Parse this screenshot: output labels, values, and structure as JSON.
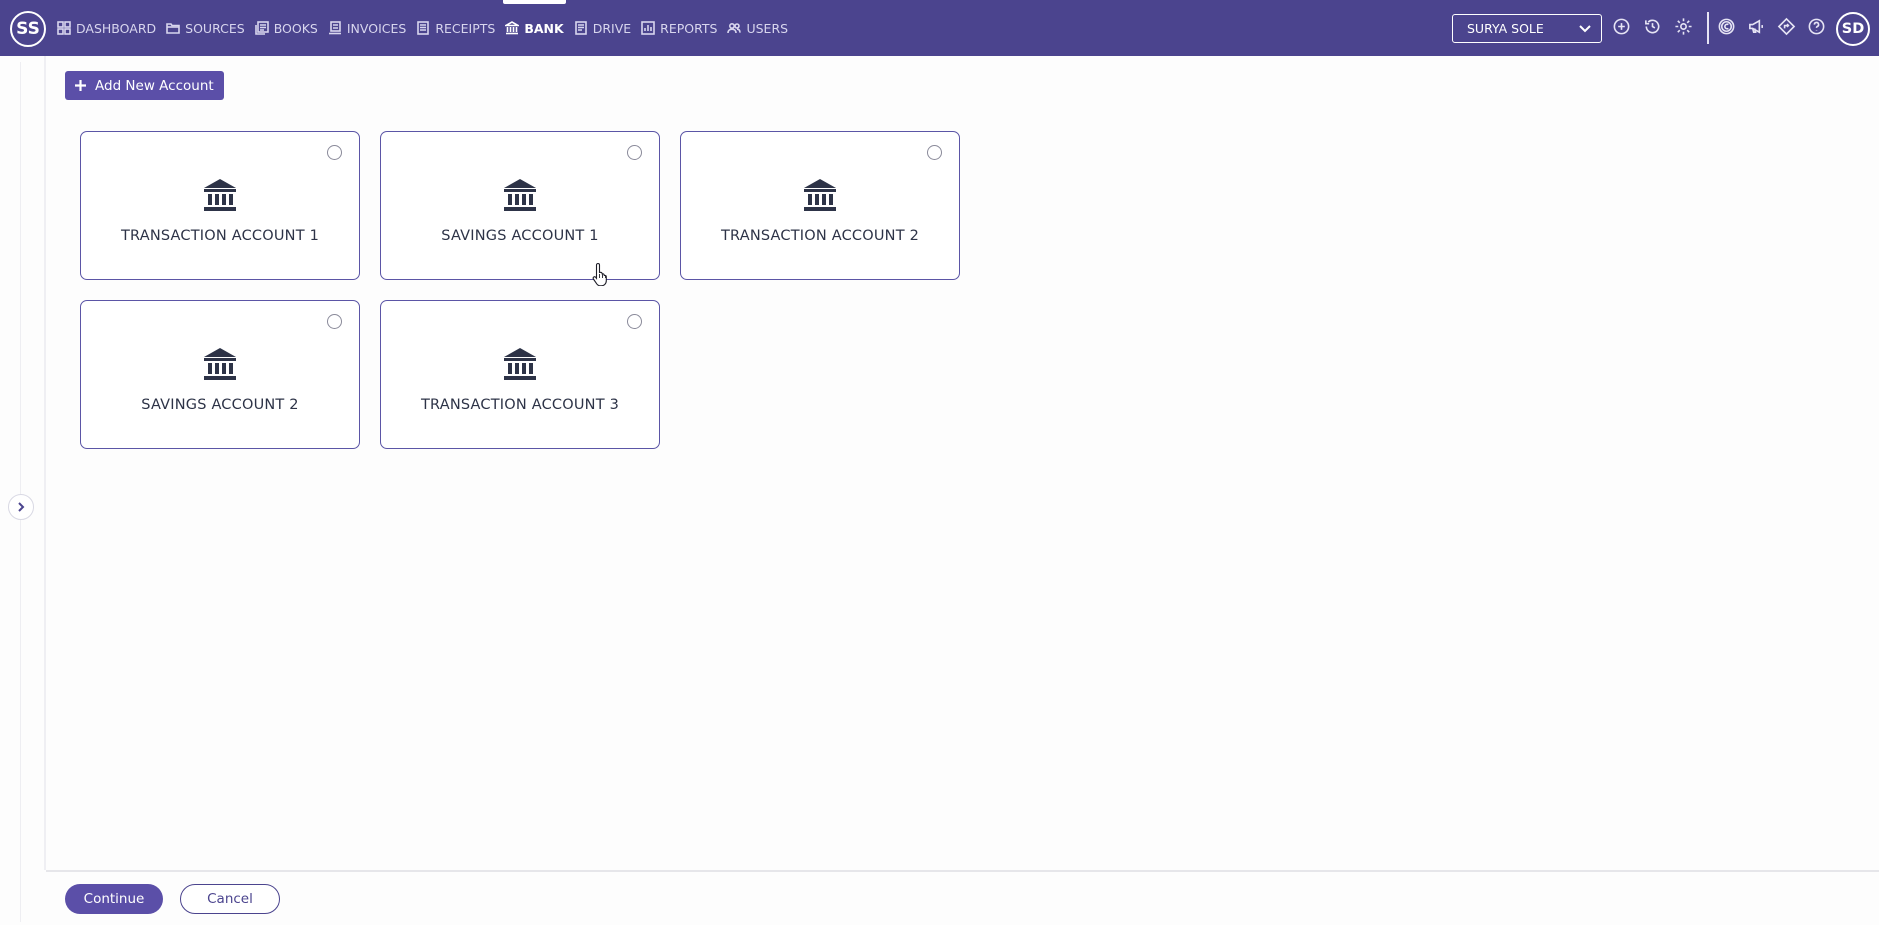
{
  "header": {
    "user_initials": "SS",
    "nav": [
      {
        "label": "DASHBOARD",
        "icon": "grid-icon",
        "active": false
      },
      {
        "label": "SOURCES",
        "icon": "folder-icon",
        "active": false
      },
      {
        "label": "BOOKS",
        "icon": "books-icon",
        "active": false
      },
      {
        "label": "INVOICES",
        "icon": "invoice-icon",
        "active": false
      },
      {
        "label": "RECEIPTS",
        "icon": "receipt-icon",
        "active": false
      },
      {
        "label": "BANK",
        "icon": "bank-icon",
        "active": true
      },
      {
        "label": "DRIVE",
        "icon": "document-icon",
        "active": false
      },
      {
        "label": "REPORTS",
        "icon": "chart-icon",
        "active": false
      },
      {
        "label": "USERS",
        "icon": "users-icon",
        "active": false
      }
    ],
    "company_select": {
      "value": "SURYA SOLE"
    },
    "account_initials": "SD"
  },
  "toolbar": {
    "add_account_label": "Add New Account"
  },
  "accounts": [
    {
      "name": "TRANSACTION ACCOUNT 1",
      "selected": false
    },
    {
      "name": "SAVINGS ACCOUNT 1",
      "selected": false
    },
    {
      "name": "TRANSACTION ACCOUNT 2",
      "selected": false
    },
    {
      "name": "SAVINGS ACCOUNT 2",
      "selected": false
    },
    {
      "name": "TRANSACTION ACCOUNT 3",
      "selected": false
    }
  ],
  "footer": {
    "continue_label": "Continue",
    "cancel_label": "Cancel"
  },
  "colors": {
    "brand": "#4b448e",
    "accent": "#5b4fa8",
    "card_border": "#5b55a6",
    "icon": "#2d3347"
  }
}
